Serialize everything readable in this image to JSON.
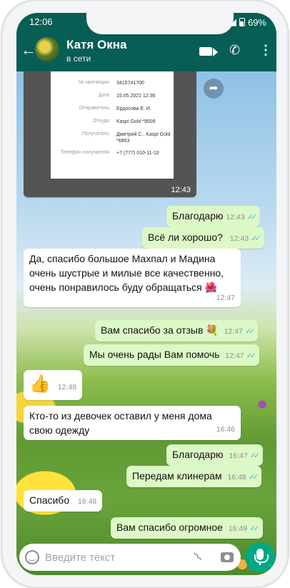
{
  "status_bar": {
    "time": "12:06",
    "battery": "69%"
  },
  "contact": {
    "name": "Катя Окна",
    "presence": "в сети"
  },
  "receipt": {
    "rows": [
      {
        "label": "№ квитанции",
        "value": "3415741700"
      },
      {
        "label": "Дата",
        "value": "15.05.2021 12:36"
      },
      {
        "label": "Отправитель",
        "value": "Ердосова Е. И."
      },
      {
        "label": "Откуда",
        "value": "Kaspi Gold *9009"
      },
      {
        "label": "Получатель",
        "value": "Дмитрий С., Kaspi Gold *6863"
      },
      {
        "label": "Телефон получателя",
        "value": "+7 (777) 010-11-10"
      }
    ],
    "time": "12:43"
  },
  "messages": [
    {
      "dir": "out",
      "text": "Благодарю",
      "time": "12:43"
    },
    {
      "dir": "out",
      "text": "Всё ли хорошо?",
      "time": "12:43"
    },
    {
      "dir": "in",
      "text": "Да, спасибо большое Махпал и Мадина очень шустрые и милые все качественно, очень понравилось буду обращаться 🌺",
      "time": "12:47"
    },
    {
      "dir": "out",
      "text": "Вам спасибо за отзыв 💐",
      "time": "12:47"
    },
    {
      "dir": "out",
      "text": "Мы очень рады Вам помочь",
      "time": "12:47"
    },
    {
      "dir": "in",
      "text": "👍",
      "time": "12:48"
    },
    {
      "dir": "in",
      "text": "Кто-то из девочек оставил у меня дома свою одежду",
      "time": "16:46"
    },
    {
      "dir": "out",
      "text": "Благодарю",
      "time": "16:47"
    },
    {
      "dir": "out",
      "text": "Передам клинерам",
      "time": "16:48"
    },
    {
      "dir": "in",
      "text": "Спасибо",
      "time": "16:48"
    },
    {
      "dir": "out",
      "text": "Вам спасибо огромное",
      "time": "16:49"
    }
  ],
  "composer": {
    "placeholder": "Введите текст"
  }
}
